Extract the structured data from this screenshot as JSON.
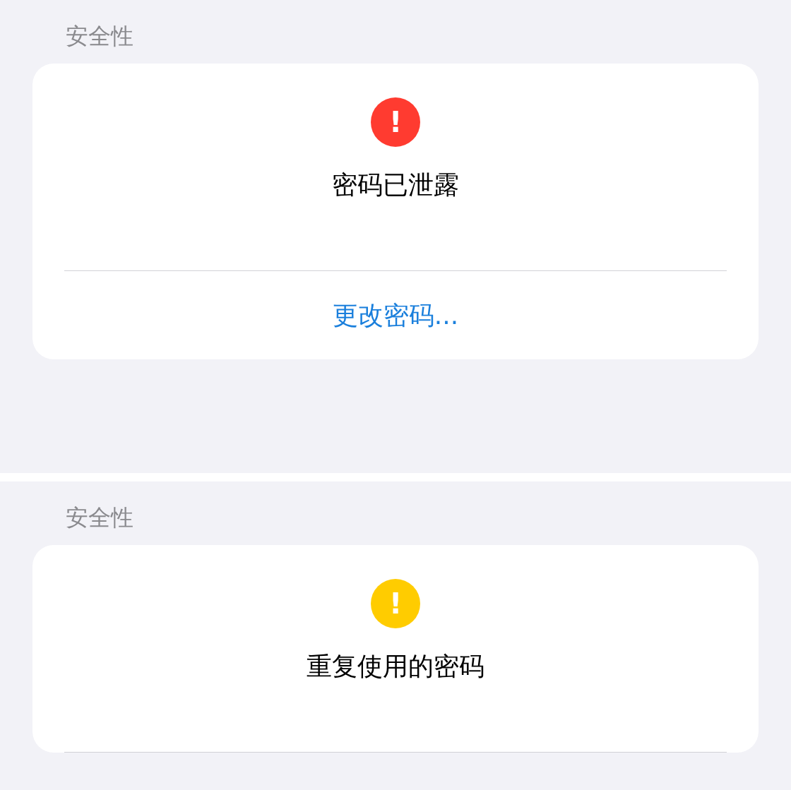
{
  "panels": [
    {
      "section_header": "安全性",
      "alert": {
        "color": "#ff3b30",
        "mark": "!",
        "title": "密码已泄露"
      },
      "action": "更改密码..."
    },
    {
      "section_header": "安全性",
      "alert": {
        "color": "#ffcc00",
        "mark": "!",
        "title": "重复使用的密码"
      }
    }
  ]
}
